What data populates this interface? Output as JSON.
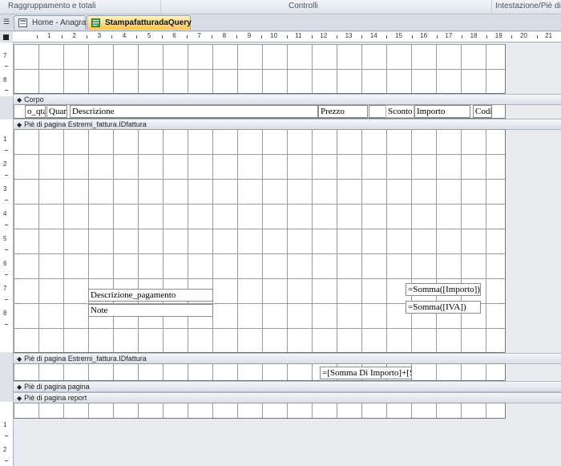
{
  "ribbon": {
    "groups": [
      "Raggruppamento e totali",
      "Controlli",
      "Intestazione/Piè di p"
    ]
  },
  "tabs": [
    {
      "label": "Home - Anagrafica"
    },
    {
      "label": "StampafatturadaQuery"
    }
  ],
  "ruler": {
    "h_numbers": [
      "1",
      "2",
      "3",
      "4",
      "5",
      "6",
      "7",
      "8",
      "9",
      "10",
      "11",
      "12",
      "13",
      "14",
      "15",
      "16",
      "17",
      "18",
      "19",
      "20",
      "21"
    ],
    "v_top": [
      "7",
      "8"
    ],
    "v_mid": [
      "1",
      "2",
      "3",
      "4",
      "5",
      "6",
      "7",
      "8"
    ],
    "v_bottom": [
      "1",
      "2"
    ]
  },
  "sections": {
    "corpo": "Corpo",
    "pie_estremi_1": "Piè di pagina Estremi_fattura.IDfattura",
    "pie_estremi_2": "Piè di pagina Estremi_fattura.IDfattura",
    "pie_pagina": "Piè di pagina pagina",
    "pie_report": "Piè di pagina report"
  },
  "detail_controls": {
    "qta": "o_qta",
    "quantita": "Quan",
    "descrizione": "Descrizione",
    "prezzo": "Prezzo",
    "sconto": "Sconto",
    "importo": "Importo",
    "codice": "Codi"
  },
  "footer_controls": {
    "descrizione_pagamento": "Descrizione_pagamento",
    "note": "Note",
    "somma_importo": "=Somma([Importo])",
    "somma_iva": "=Somma([IVA])",
    "somma_totale": "=[Somma Di Importo]+[So"
  }
}
